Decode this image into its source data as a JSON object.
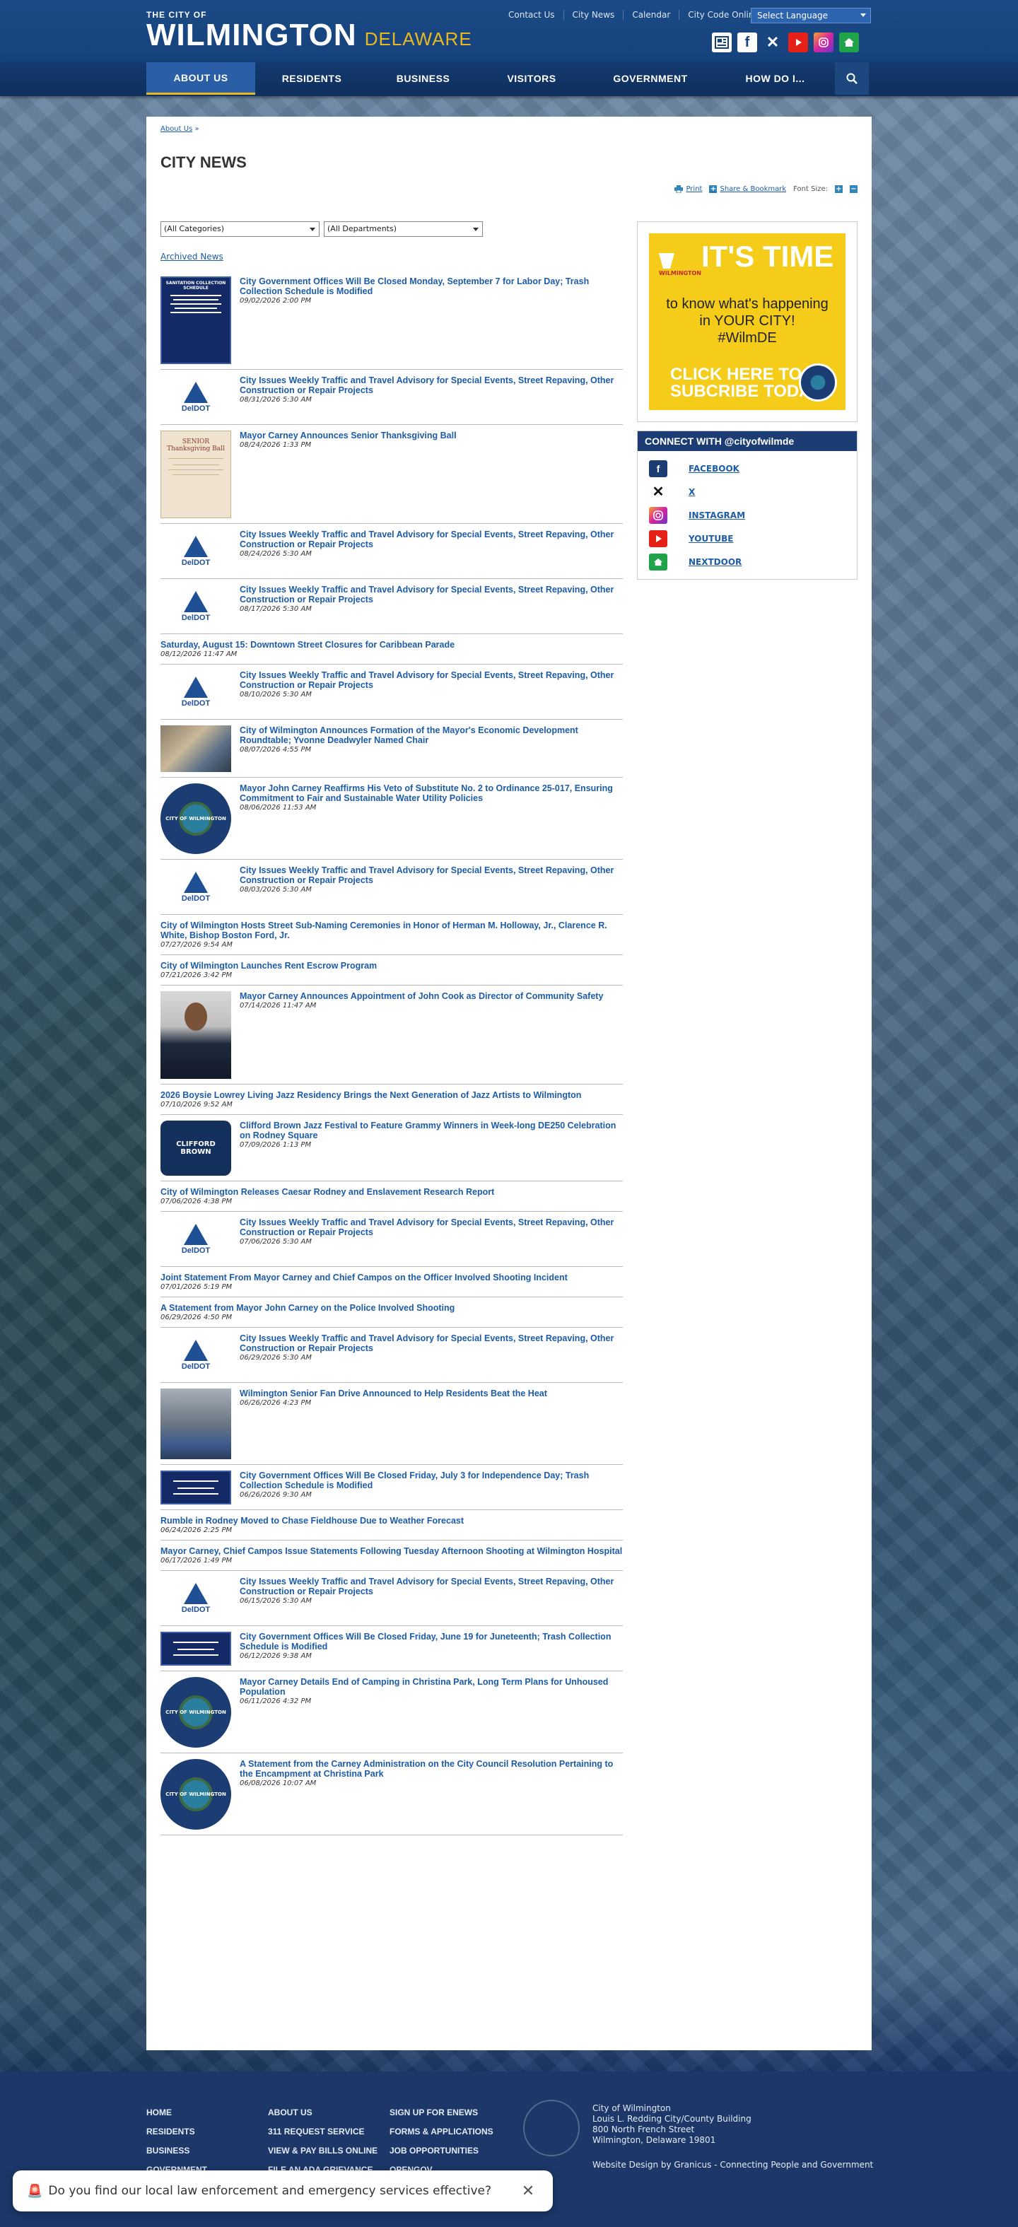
{
  "header": {
    "logo_top": "THE CITY OF",
    "logo_main": "WILMINGTON",
    "logo_state": "DELAWARE",
    "util_links": [
      "Contact Us",
      "City News",
      "Calendar",
      "City Code Online"
    ],
    "language": "Select Language"
  },
  "nav": {
    "items": [
      "ABOUT US",
      "RESIDENTS",
      "BUSINESS",
      "VISITORS",
      "GOVERNMENT",
      "HOW DO I..."
    ]
  },
  "breadcrumb": {
    "link": "About Us",
    "sep": "»"
  },
  "page_title": "CITY NEWS",
  "tools": {
    "print": "Print",
    "share": "Share & Bookmark",
    "font_size": "Font Size:",
    "plus": "+",
    "minus": "−"
  },
  "filters": {
    "category": "(All Categories)",
    "department": "(All Departments)"
  },
  "archived": "Archived News",
  "news": [
    {
      "title": "City Government Offices Will Be Closed Monday, September 7 for Labor Day; Trash Collection Schedule is Modified",
      "date": "09/02/2026 2:00 PM",
      "thumb": "notice"
    },
    {
      "title": "City Issues Weekly Traffic and Travel Advisory for Special Events, Street Repaving, Other Construction or Repair Projects",
      "date": "08/31/2026 5:30 AM",
      "thumb": "deldot"
    },
    {
      "title": "Mayor Carney Announces Senior Thanksgiving Ball",
      "date": "08/24/2026 1:33 PM",
      "thumb": "flyer"
    },
    {
      "title": "City Issues Weekly Traffic and Travel Advisory for Special Events, Street Repaving, Other Construction or Repair Projects",
      "date": "08/24/2026 5:30 AM",
      "thumb": "deldot"
    },
    {
      "title": "City Issues Weekly Traffic and Travel Advisory for Special Events, Street Repaving, Other Construction or Repair Projects",
      "date": "08/17/2026 5:30 AM",
      "thumb": "deldot"
    },
    {
      "title": "Saturday, August 15: Downtown Street Closures for Caribbean Parade",
      "date": "08/12/2026 11:47 AM",
      "thumb": "none"
    },
    {
      "title": "City Issues Weekly Traffic and Travel Advisory for Special Events, Street Repaving, Other Construction or Repair Projects",
      "date": "08/10/2026 5:30 AM",
      "thumb": "deldot"
    },
    {
      "title": "City of Wilmington Announces Formation of the Mayor's Economic Development Roundtable; Yvonne Deadwyler Named Chair",
      "date": "08/07/2026 4:55 PM",
      "thumb": "photo-group"
    },
    {
      "title": "Mayor John Carney Reaffirms His Veto of Substitute No. 2 to Ordinance 25-017, Ensuring Commitment to Fair and Sustainable Water Utility Policies",
      "date": "08/06/2026 11:53 AM",
      "thumb": "seal"
    },
    {
      "title": "City Issues Weekly Traffic and Travel Advisory for Special Events, Street Repaving, Other Construction or Repair Projects",
      "date": "08/03/2026 5:30 AM",
      "thumb": "deldot"
    },
    {
      "title": "City of Wilmington Hosts Street Sub-Naming Ceremonies in Honor of Herman M. Holloway, Jr., Clarence R. White, Bishop Boston Ford, Jr.",
      "date": "07/27/2026 9:54 AM",
      "thumb": "none"
    },
    {
      "title": "City of Wilmington Launches Rent Escrow Program",
      "date": "07/21/2026 3:42 PM",
      "thumb": "none"
    },
    {
      "title": "Mayor Carney Announces Appointment of John Cook as Director of Community Safety",
      "date": "07/14/2026 11:47 AM",
      "thumb": "portrait"
    },
    {
      "title": "2026 Boysie Lowrey Living Jazz Residency Brings the Next Generation of Jazz Artists to Wilmington",
      "date": "07/10/2026 9:52 AM",
      "thumb": "none"
    },
    {
      "title": "Clifford Brown Jazz Festival to Feature Grammy Winners in Week-long DE250 Celebration on Rodney Square",
      "date": "07/09/2026 1:13 PM",
      "thumb": "jazz"
    },
    {
      "title": "City of Wilmington Releases Caesar Rodney and Enslavement Research Report",
      "date": "07/06/2026 4:38 PM",
      "thumb": "none"
    },
    {
      "title": "City Issues Weekly Traffic and Travel Advisory for Special Events, Street Repaving, Other Construction or Repair Projects",
      "date": "07/06/2026 5:30 AM",
      "thumb": "deldot"
    },
    {
      "title": "Joint Statement From Mayor Carney and Chief Campos on the Officer Involved Shooting Incident",
      "date": "07/01/2026 5:19 PM",
      "thumb": "none"
    },
    {
      "title": "A Statement from Mayor John Carney on the Police Involved Shooting",
      "date": "06/29/2026 4:50 PM",
      "thumb": "none"
    },
    {
      "title": "City Issues Weekly Traffic and Travel Advisory for Special Events, Street Repaving, Other Construction or Repair Projects",
      "date": "06/29/2026 5:30 AM",
      "thumb": "deldot"
    },
    {
      "title": "Wilmington Senior Fan Drive Announced to Help Residents Beat the Heat",
      "date": "06/26/2026 4:23 PM",
      "thumb": "photo-fans"
    },
    {
      "title": "City Government Offices Will Be Closed Friday, July 3 for Independence Day; Trash Collection Schedule is Modified",
      "date": "06/26/2026 9:30 AM",
      "thumb": "notice-wide"
    },
    {
      "title": "Rumble in Rodney Moved to Chase Fieldhouse Due to Weather Forecast",
      "date": "06/24/2026 2:25 PM",
      "thumb": "none"
    },
    {
      "title": "Mayor Carney, Chief Campos Issue Statements Following Tuesday Afternoon Shooting at Wilmington Hospital",
      "date": "06/17/2026 1:49 PM",
      "thumb": "none"
    },
    {
      "title": "City Issues Weekly Traffic and Travel Advisory for Special Events, Street Repaving, Other Construction or Repair Projects",
      "date": "06/15/2026 5:30 AM",
      "thumb": "deldot"
    },
    {
      "title": "City Government Offices Will Be Closed Friday, June 19 for Juneteenth; Trash Collection Schedule is Modified",
      "date": "06/12/2026 9:38 AM",
      "thumb": "notice-wide"
    },
    {
      "title": "Mayor Carney Details End of Camping in Christina Park, Long Term Plans for Unhoused Population",
      "date": "06/11/2026 4:32 PM",
      "thumb": "seal"
    },
    {
      "title": "A Statement from the Carney Administration on the City Council Resolution Pertaining to the Encampment at Christina Park",
      "date": "06/08/2026 10:07 AM",
      "thumb": "seal"
    }
  ],
  "thumb_text": {
    "deldot": "DelDOT",
    "notice_title": "SANITATION COLLECTION SCHEDULE",
    "seal": "CITY OF WILMINGTON",
    "jazz": "CLIFFORD BROWN",
    "flyer_title": "SENIOR Thanksgiving Ball"
  },
  "promo": {
    "badge": "WILMINGTON",
    "headline": "IT'S TIME",
    "line1": "to know what's happening",
    "line2": "in YOUR CITY!",
    "hashtag": "#WilmDE",
    "cta1": "CLICK HERE TO",
    "cta2": "SUBCRIBE TODAY"
  },
  "connect": {
    "heading": "CONNECT WITH @cityofwilmde",
    "items": [
      "FACEBOOK",
      "X",
      "INSTAGRAM",
      "YOUTUBE",
      "NEXTDOOR"
    ]
  },
  "footer": {
    "col1": [
      "HOME",
      "RESIDENTS",
      "BUSINESS",
      "GOVERNMENT"
    ],
    "col2": [
      "ABOUT US",
      "311 REQUEST SERVICE",
      "VIEW & PAY BILLS ONLINE",
      "FILE AN ADA GRIEVANCE"
    ],
    "col3": [
      "SIGN UP FOR ENEWS",
      "FORMS & APPLICATIONS",
      "JOB OPPORTUNITIES",
      "OPENGOV"
    ],
    "address": [
      "City of Wilmington",
      "Louis L. Redding City/County Building",
      "800 North French Street",
      "Wilmington, Delaware 19801"
    ],
    "credit": "Website Design by Granicus - Connecting People and Government"
  },
  "survey": {
    "text": "Do you find our local law enforcement and emergency services effective?",
    "close": "✕"
  },
  "colors": {
    "brand_blue": "#1b4a86",
    "link_blue": "#1d5ca8",
    "gold": "#e8b820",
    "promo_yellow": "#f5cc1a"
  }
}
